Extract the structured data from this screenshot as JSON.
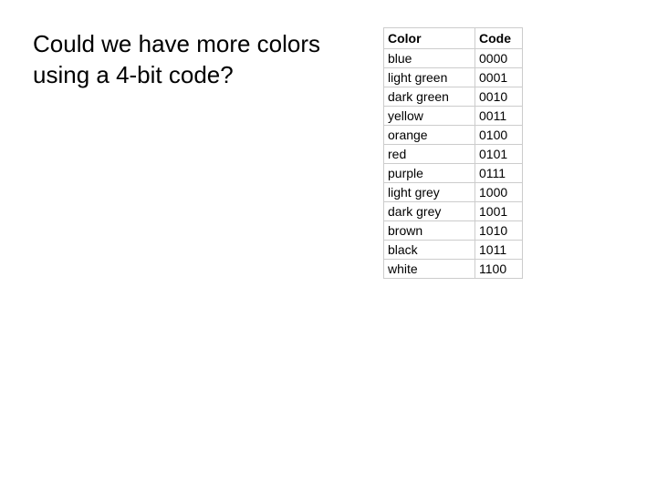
{
  "question": "Could we have more colors using a 4-bit code?",
  "table": {
    "header": {
      "color": "Color",
      "code": "Code"
    },
    "rows": [
      {
        "color": "blue",
        "code": "0000"
      },
      {
        "color": "light green",
        "code": "0001"
      },
      {
        "color": "dark green",
        "code": "0010"
      },
      {
        "color": "yellow",
        "code": "0011"
      },
      {
        "color": "orange",
        "code": "0100"
      },
      {
        "color": "red",
        "code": "0101"
      },
      {
        "color": "purple",
        "code": "0111"
      },
      {
        "color": "light grey",
        "code": "1000"
      },
      {
        "color": "dark grey",
        "code": "1001"
      },
      {
        "color": "brown",
        "code": "1010"
      },
      {
        "color": "black",
        "code": "1011"
      },
      {
        "color": "white",
        "code": "1100"
      }
    ]
  }
}
